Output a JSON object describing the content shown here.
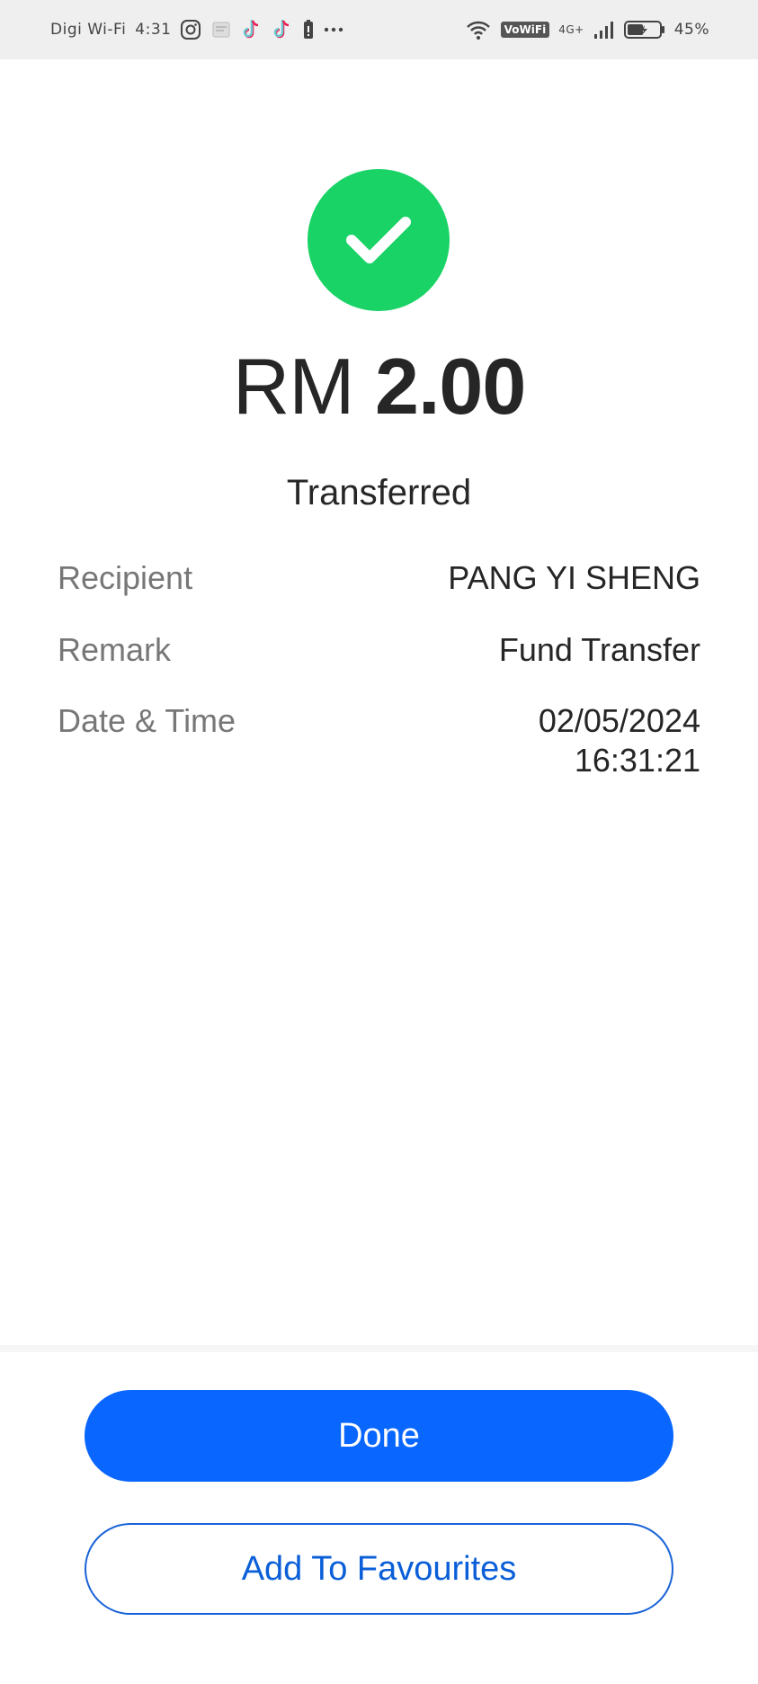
{
  "status_bar": {
    "carrier": "Digi Wi-Fi",
    "time": "4:31",
    "network_badge": "VoWiFi",
    "network_type": "4G+",
    "battery": "45%",
    "icons": [
      "instagram-icon",
      "gallery-icon",
      "tiktok-icon",
      "tiktok-icon",
      "battery-saver-icon",
      "more-icon",
      "wifi-icon",
      "signal-icon",
      "battery-icon"
    ]
  },
  "receipt": {
    "currency": "RM",
    "amount": "2.00",
    "status": "Transferred",
    "details": {
      "recipient_label": "Recipient",
      "recipient_value": "PANG YI SHENG",
      "remark_label": "Remark",
      "remark_value": "Fund Transfer",
      "datetime_label": "Date & Time",
      "date_value": "02/05/2024",
      "time_value": "16:31:21"
    }
  },
  "actions": {
    "done_label": "Done",
    "favourites_label": "Add To Favourites"
  },
  "colors": {
    "success": "#19d366",
    "primary": "#0966ff",
    "outline": "#1a63d8"
  }
}
